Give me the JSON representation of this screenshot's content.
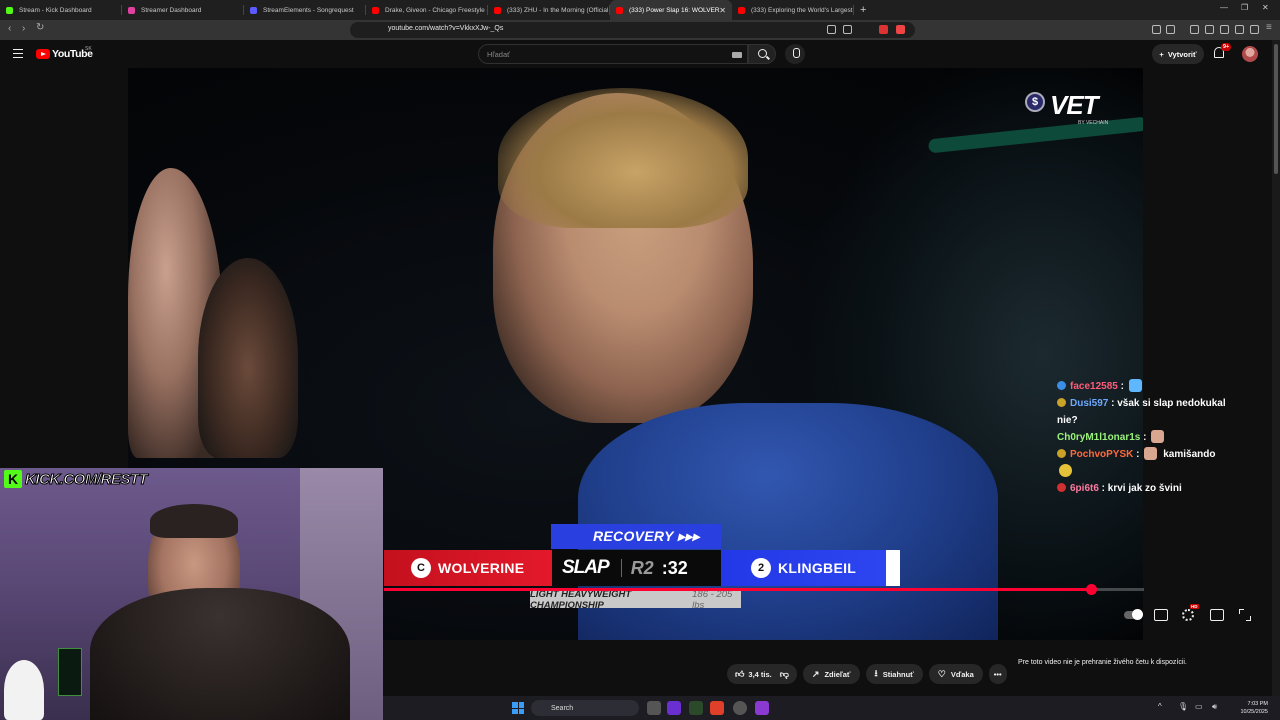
{
  "browser": {
    "tabs": [
      {
        "title": "Stream - Kick Dashboard",
        "fav": "#53fc18",
        "active": false
      },
      {
        "title": "Streamer Dashboard",
        "fav": "#e040a0",
        "active": false
      },
      {
        "title": "StreamElements - Songrequest",
        "fav": "#5b5bff",
        "active": false
      },
      {
        "title": "Drake, Giveon - Chicago Freestyle (A",
        "fav": "#ff0000",
        "active": false
      },
      {
        "title": "(333) ZHU - In the Morning (Official V",
        "fav": "#ff0000",
        "active": false
      },
      {
        "title": "(333) Power Slap 16: WOLVER",
        "fav": "#ff0000",
        "active": true
      },
      {
        "title": "(333) Exploring the World's Largest I",
        "fav": "#ff0000",
        "active": false
      }
    ],
    "new_tab": "+",
    "url": "youtube.com/watch?v=VkkxXJw-_Qs"
  },
  "youtube": {
    "logo_text": "YouTube",
    "country": "SK",
    "search_placeholder": "Hľadať",
    "create_label": "Vytvoriť",
    "notif_badge": "9+"
  },
  "video": {
    "sponsor": "VET",
    "sponsor_coin": "$",
    "sponsor_sub": "BY VECHAIN",
    "recovery_label": "RECOVERY ▸▸▸",
    "fighter_left": {
      "seed": "C",
      "name": "WOLVERINE"
    },
    "fighter_right": {
      "seed": "2",
      "name": "KLINGBEIL"
    },
    "slap_logo": "SLAP",
    "round": "R2",
    "clock": ":32",
    "championship": "LIGHT HEAVYWEIGHT CHAMPIONSHIP",
    "weight_class": "186 - 205 lbs",
    "progress": 0.93,
    "hd_badge": "HD"
  },
  "chat": [
    {
      "badge": "#3a8ee6",
      "user": "face12585",
      "color": "#ff5c7a",
      "msg": "",
      "emote": "#5fb7ff"
    },
    {
      "badge": "#c9a227",
      "user": "Dusi597",
      "color": "#6fa8ff",
      "msg": "však si slap nedokukal nie?",
      "emote": ""
    },
    {
      "badge": "",
      "user": "Ch0ryM1l1onar1s",
      "color": "#9bf27a",
      "msg": "",
      "emote": "#d9a78f"
    },
    {
      "badge": "#c9a227",
      "user": "PochvoPYSK",
      "color": "#ff6a3d",
      "msg": "kamišando",
      "emote": "#d9a78f",
      "emote2": "#e6c23a"
    },
    {
      "badge": "#d03030",
      "user": "6pi6t6",
      "color": "#ff7aa0",
      "msg": "krvi jak zo švini",
      "emote": ""
    }
  ],
  "webcam": {
    "kick_k": "K",
    "kick_url": "KICK.COM/RESTT"
  },
  "actions": {
    "likes": "3,4 tis.",
    "share": "Zdieľať",
    "download": "Stiahnuť",
    "thanks": "Vďaka",
    "more": "•••"
  },
  "live_chat_unavailable": "Pre toto video nie je prehranie živého četu k dispozícii.",
  "taskbar": {
    "search": "Search",
    "time": "7:03 PM",
    "date": "10/25/2025"
  }
}
